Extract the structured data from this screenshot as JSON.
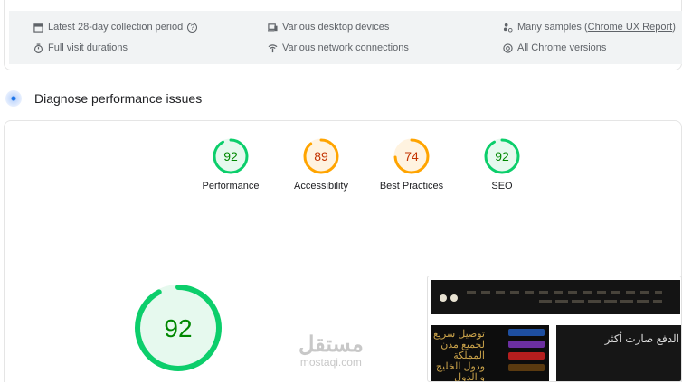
{
  "field_info": {
    "items": [
      {
        "icon": "calendar-icon",
        "label": "Latest 28-day collection period",
        "help": "?"
      },
      {
        "icon": "stopwatch-icon",
        "label": "Full visit durations"
      },
      {
        "icon": "devices-icon",
        "label": "Various desktop devices"
      },
      {
        "icon": "network-icon",
        "label": "Various network connections"
      },
      {
        "icon": "samples-icon",
        "label": "Many samples (",
        "link": "Chrome UX Report",
        "suffix": ")"
      },
      {
        "icon": "chrome-icon",
        "label": "All Chrome versions"
      }
    ]
  },
  "diagnose": {
    "title": "Diagnose performance issues"
  },
  "scores": [
    {
      "label": "Performance",
      "value": 92,
      "color": "#0cce6b"
    },
    {
      "label": "Accessibility",
      "value": 89,
      "color": "#ffa400"
    },
    {
      "label": "Best Practices",
      "value": 74,
      "color": "#ffa400"
    },
    {
      "label": "SEO",
      "value": 92,
      "color": "#0cce6b"
    }
  ],
  "main_score": {
    "value": 92,
    "color": "#0cce6b"
  },
  "screenshot": {
    "banner1": "توصيل سريع لجميع مدن المملكة ودول الخليج و الدول العربية",
    "banner2": "الدفع صارت أكثر"
  },
  "watermark": {
    "arabic": "مستقل",
    "latin": "mostaqi.com"
  }
}
